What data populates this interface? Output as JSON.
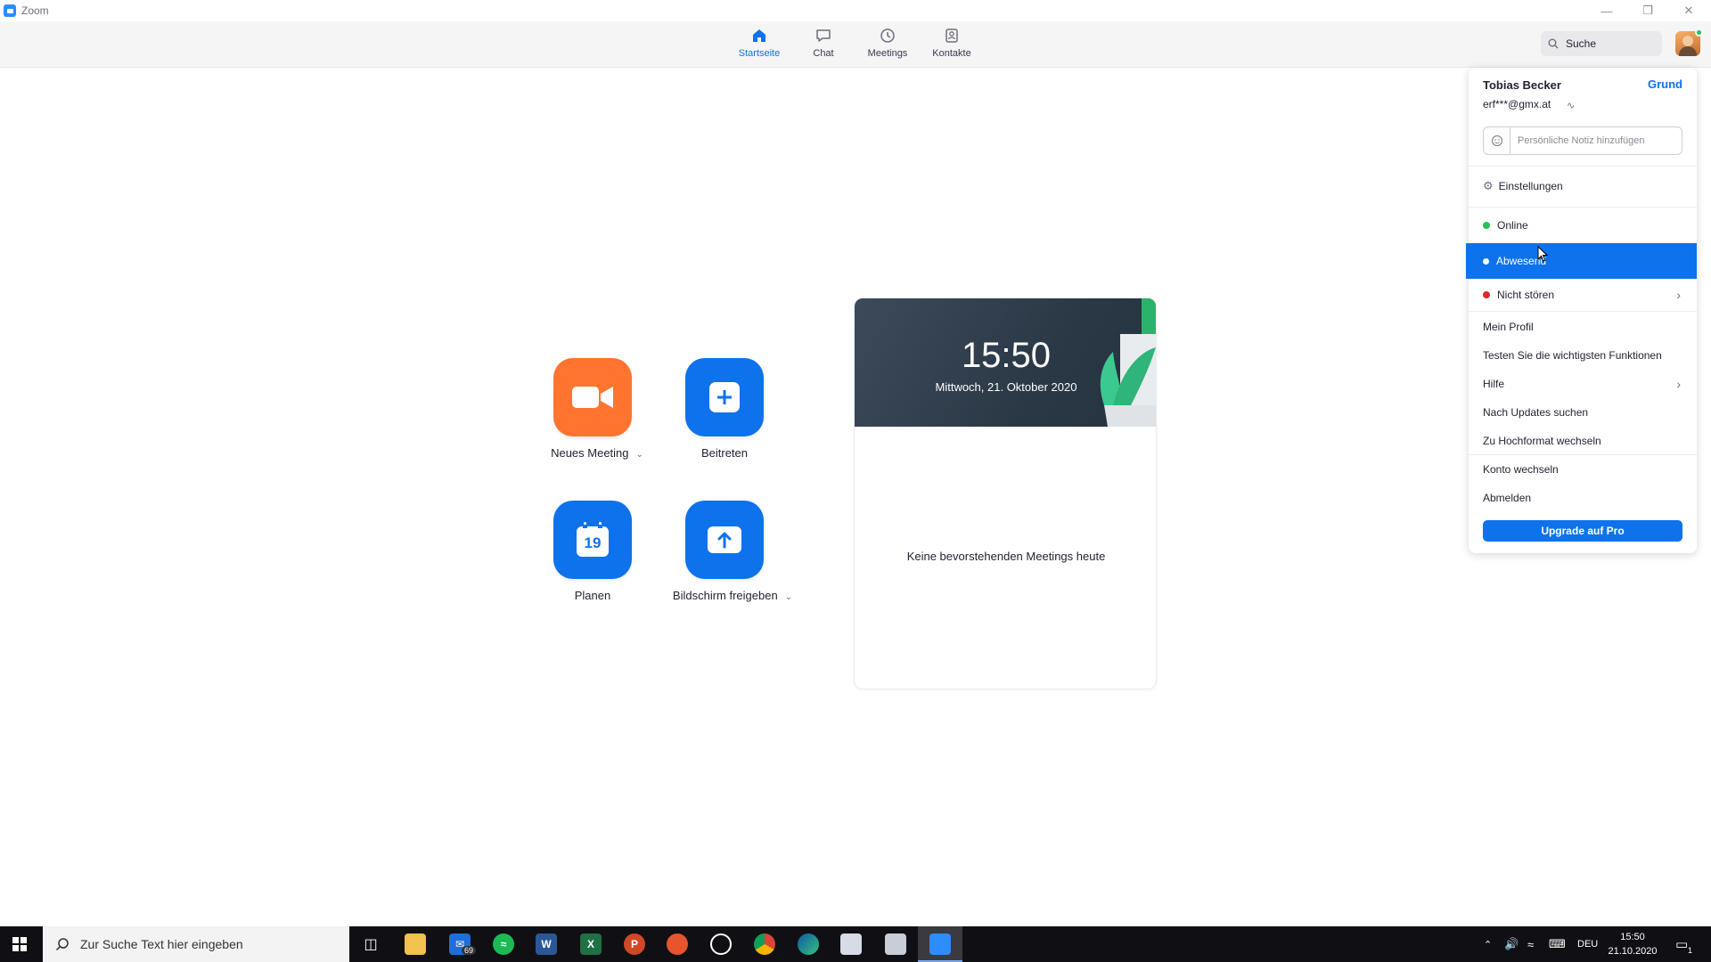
{
  "window": {
    "title": "Zoom"
  },
  "nav": {
    "tabs": [
      {
        "label": "Startseite",
        "icon": "home-icon",
        "active": true
      },
      {
        "label": "Chat",
        "icon": "chat-icon",
        "active": false
      },
      {
        "label": "Meetings",
        "icon": "clock-icon",
        "active": false
      },
      {
        "label": "Kontakte",
        "icon": "contacts-icon",
        "active": false
      }
    ],
    "search_label": "Suche"
  },
  "actions": {
    "new_meeting": "Neues Meeting",
    "join": "Beitreten",
    "schedule": "Planen",
    "calendar_day": "19",
    "share_screen": "Bildschirm freigeben"
  },
  "meetings_card": {
    "time": "15:50",
    "date": "Mittwoch, 21. Oktober 2020",
    "empty_message": "Keine bevorstehenden Meetings heute"
  },
  "profile_menu": {
    "name": "Tobias Becker",
    "account_type": "Grund",
    "email": "erf***@gmx.at",
    "note_placeholder": "Persönliche Notiz hinzufügen",
    "settings": "Einstellungen",
    "status_online": "Online",
    "status_away": "Abwesend",
    "status_dnd": "Nicht stören",
    "my_profile": "Mein Profil",
    "test_features": "Testen Sie die wichtigsten Funktionen",
    "help": "Hilfe",
    "check_updates": "Nach Updates suchen",
    "portrait_mode": "Zu Hochformat wechseln",
    "switch_account": "Konto wechseln",
    "sign_out": "Abmelden",
    "upgrade": "Upgrade auf Pro"
  },
  "taskbar": {
    "search_placeholder": "Zur Suche Text hier eingeben",
    "mail_badge": "69",
    "language": "DEU",
    "time": "15:50",
    "date": "21.10.2020",
    "notification_count": "1"
  },
  "colors": {
    "accent": "#0e72ed",
    "new_meeting": "#ff742e",
    "online": "#24c453",
    "dnd": "#e02828"
  }
}
